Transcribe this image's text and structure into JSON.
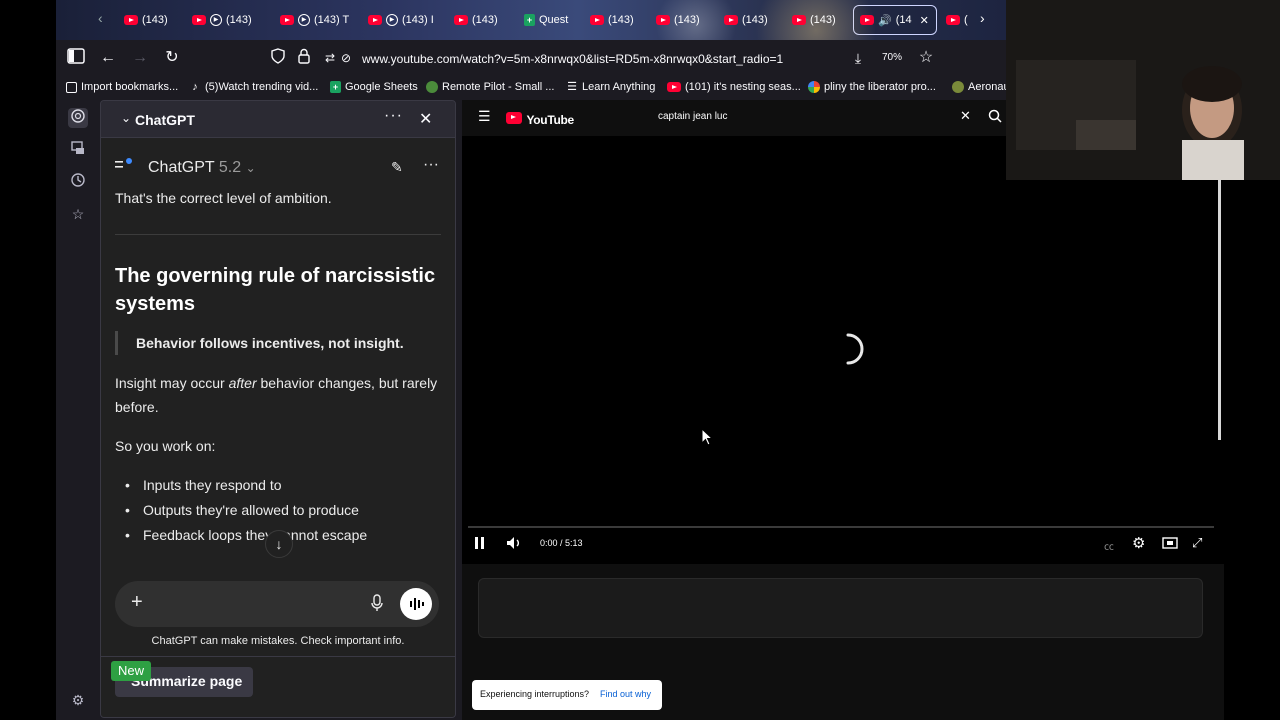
{
  "browser": {
    "tabs": [
      {
        "label": "(143)",
        "icon": "youtube-icon"
      },
      {
        "label": "(143)",
        "icon": "youtube-icon"
      },
      {
        "label": "(143) T",
        "icon": "youtube-icon"
      },
      {
        "label": "(143) I",
        "icon": "youtube-icon"
      },
      {
        "label": "(143)",
        "icon": "youtube-icon"
      },
      {
        "label": "Quest",
        "icon": "google-sheets-icon"
      },
      {
        "label": "(143)",
        "icon": "youtube-icon"
      },
      {
        "label": "(143)",
        "icon": "youtube-icon"
      },
      {
        "label": "(143)",
        "icon": "youtube-icon"
      },
      {
        "label": "(143)",
        "icon": "youtube-icon"
      },
      {
        "label": "(14",
        "icon": "youtube-icon",
        "active": true
      },
      {
        "label": "(",
        "icon": "youtube-icon"
      }
    ],
    "url": "www.youtube.com/watch?v=5m-x8nrwqx0&list=RD5m-x8nrwqx0&start_radio=1",
    "zoom": "70%",
    "bookmarks": [
      {
        "label": "Import bookmarks...",
        "icon": "import-icon"
      },
      {
        "label": "(5)Watch trending vid...",
        "icon": "tiktok-icon"
      },
      {
        "label": "Google Sheets",
        "icon": "google-sheets-icon"
      },
      {
        "label": "Remote Pilot - Small ...",
        "icon": "remote-pilot-icon"
      },
      {
        "label": "Learn Anything",
        "icon": "learn-icon"
      },
      {
        "label": "(101) it's nesting seas...",
        "icon": "youtube-icon"
      },
      {
        "label": "pliny the liberator pro...",
        "icon": "google-icon"
      },
      {
        "label": "Aeronau",
        "icon": "globe-icon"
      }
    ]
  },
  "sidebar": {
    "title": "ChatGPT",
    "model_name": "ChatGPT",
    "model_version": "5.2",
    "content": {
      "intro": "That's the correct level of ambition.",
      "heading": "The governing rule of narcissistic systems",
      "quote": "Behavior follows incentives, not insight.",
      "para1_a": "Insight may occur ",
      "para1_em": "after",
      "para1_b": " behavior changes, but rarely before.",
      "para2": "So you work on:",
      "bullets": [
        "Inputs they respond to",
        "Outputs they're allowed to produce",
        "Feedback loops they cannot escape"
      ]
    },
    "disclaimer": "ChatGPT can make mistakes. Check important info.",
    "new_badge": "New",
    "summarize_label": "Summarize page"
  },
  "youtube": {
    "logo_text": "YouTube",
    "search_value": "captain jean luc",
    "time": "0:00 / 5:13",
    "interruptions": "Experiencing interruptions?",
    "find_out_why": "Find out why"
  },
  "colors": {
    "youtube_red": "#ff0033",
    "accent_blue": "#3ea6ff",
    "new_green": "#2ea043"
  }
}
